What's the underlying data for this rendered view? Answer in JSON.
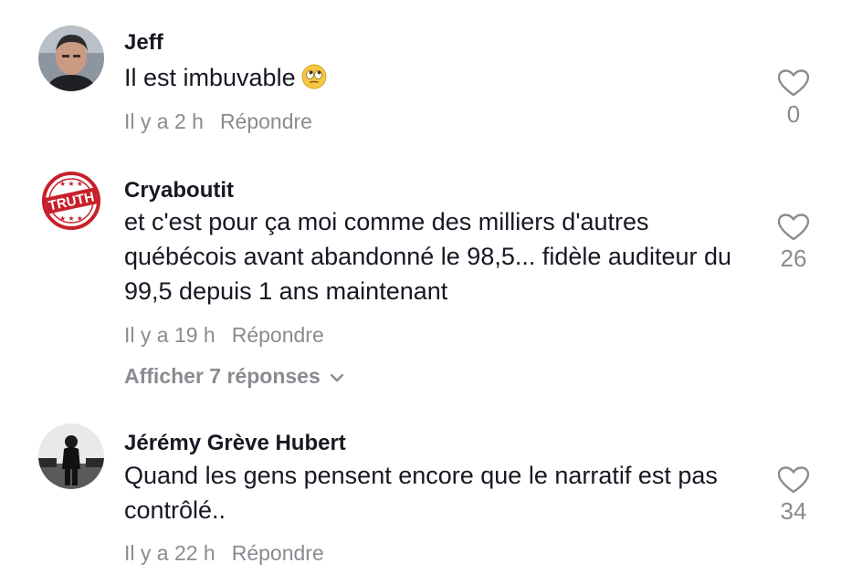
{
  "comments": [
    {
      "username": "Jeff",
      "text": "Il est imbuvable",
      "emoji": "face-with-rolling-eyes",
      "time": "Il y a 2 h",
      "reply_label": "Répondre",
      "likes": "0",
      "avatar": "man-portrait-avatar"
    },
    {
      "username": "Cryaboutit",
      "text": "et c'est pour ça moi comme des milliers d'autres québécois avant abandonné le 98,5... fidèle auditeur du 99,5 depuis 1 ans maintenant",
      "time": "Il y a 19 h",
      "reply_label": "Répondre",
      "likes": "26",
      "view_replies": "Afficher 7 réponses",
      "avatar": "truth-stamp-avatar",
      "avatar_text": "TRUTH"
    },
    {
      "username": "Jérémy Grève Hubert",
      "text": "Quand les gens pensent encore que le narratif est pas contrôlé..",
      "time": "Il y a 22 h",
      "reply_label": "Répondre",
      "likes": "34",
      "avatar": "person-street-avatar"
    }
  ],
  "icons": {
    "like": "heart-outline-icon",
    "expand": "chevron-down-icon"
  },
  "colors": {
    "primary_text": "#161823",
    "secondary_text": "#8a8b91",
    "stamp_red": "#c8202a"
  }
}
